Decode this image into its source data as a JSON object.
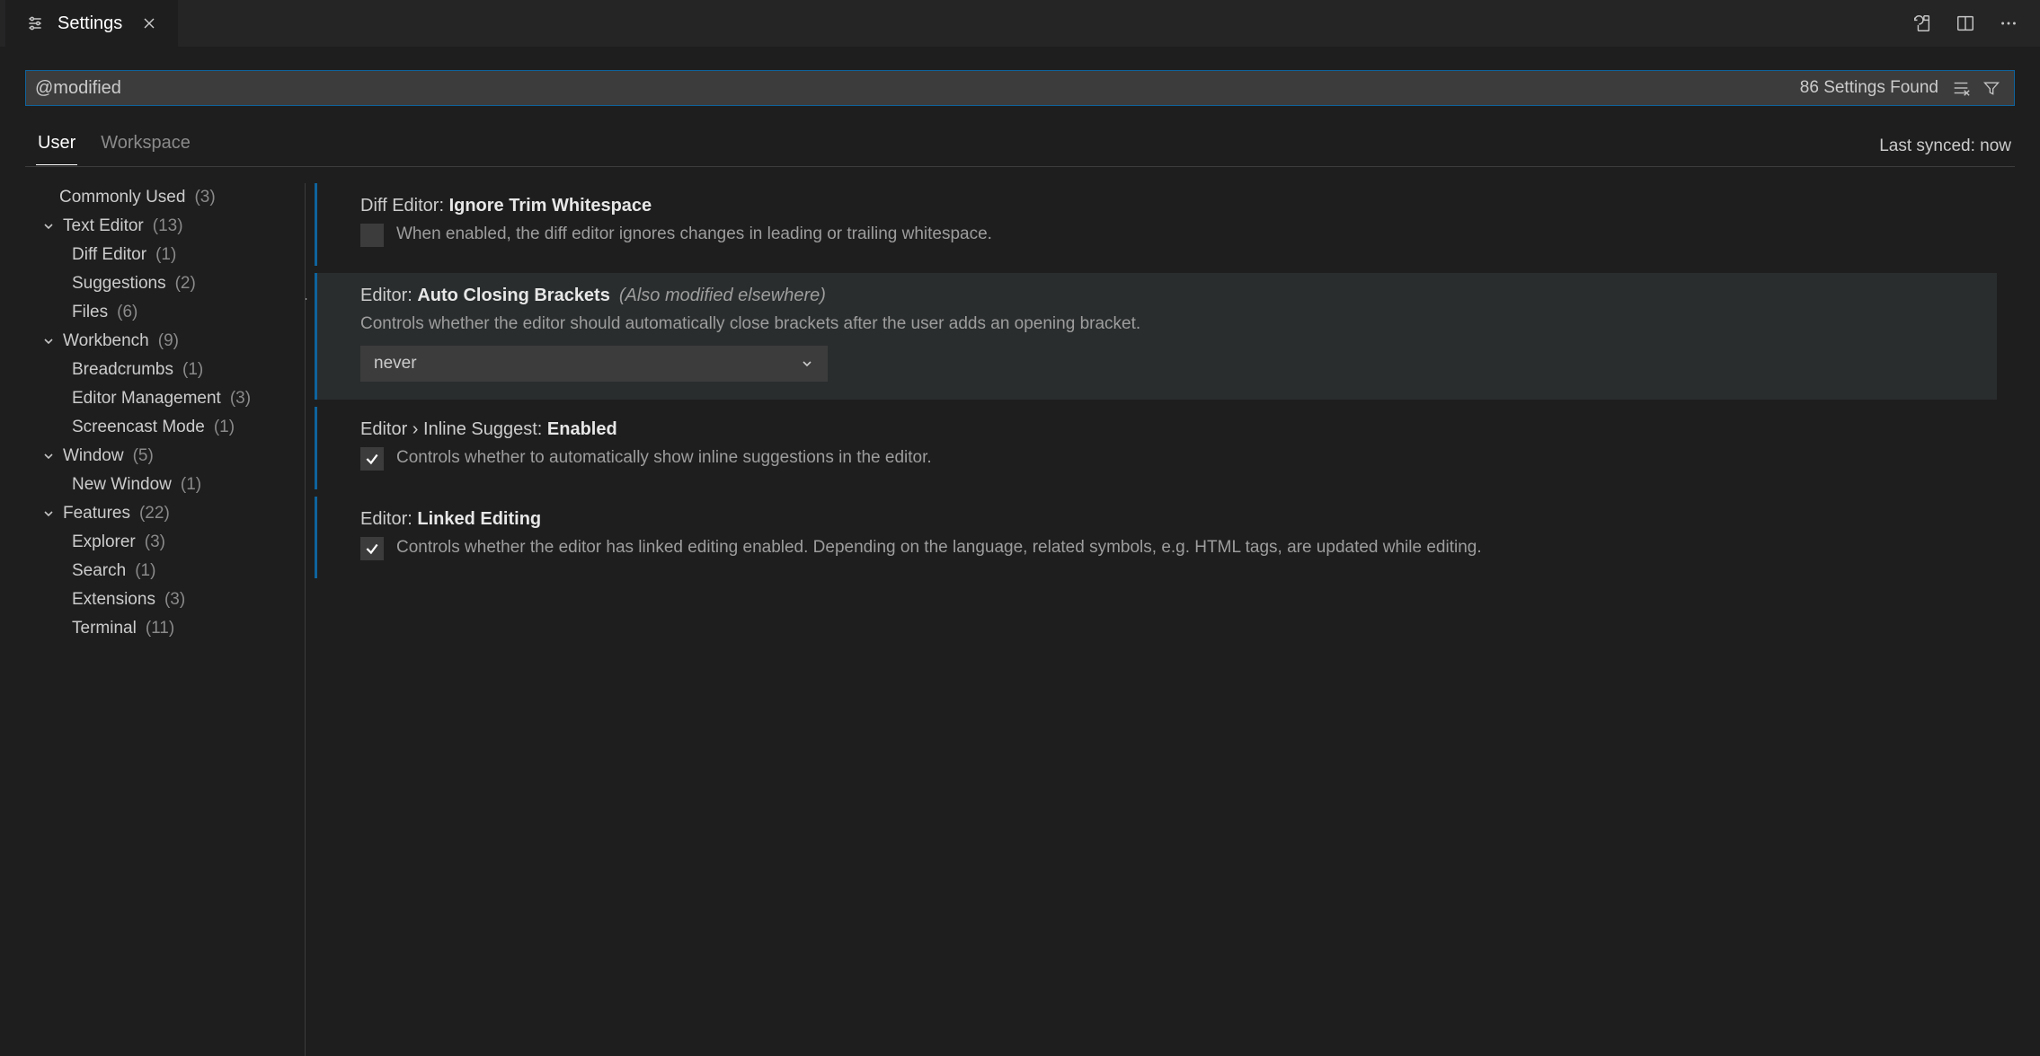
{
  "tab": {
    "title": "Settings"
  },
  "search": {
    "value": "@modified ",
    "count_label": "86 Settings Found"
  },
  "scope": {
    "tabs": [
      "User",
      "Workspace"
    ],
    "active_index": 0,
    "sync_status": "Last synced: now"
  },
  "toc": [
    {
      "kind": "root",
      "label": "Commonly Used",
      "count": "(3)"
    },
    {
      "kind": "section",
      "label": "Text Editor",
      "count": "(13)"
    },
    {
      "kind": "leaf",
      "label": "Diff Editor",
      "count": "(1)"
    },
    {
      "kind": "leaf",
      "label": "Suggestions",
      "count": "(2)"
    },
    {
      "kind": "leaf",
      "label": "Files",
      "count": "(6)"
    },
    {
      "kind": "section",
      "label": "Workbench",
      "count": "(9)"
    },
    {
      "kind": "leaf",
      "label": "Breadcrumbs",
      "count": "(1)"
    },
    {
      "kind": "leaf",
      "label": "Editor Management",
      "count": "(3)"
    },
    {
      "kind": "leaf",
      "label": "Screencast Mode",
      "count": "(1)"
    },
    {
      "kind": "section",
      "label": "Window",
      "count": "(5)"
    },
    {
      "kind": "leaf",
      "label": "New Window",
      "count": "(1)"
    },
    {
      "kind": "section",
      "label": "Features",
      "count": "(22)"
    },
    {
      "kind": "leaf",
      "label": "Explorer",
      "count": "(3)"
    },
    {
      "kind": "leaf",
      "label": "Search",
      "count": "(1)"
    },
    {
      "kind": "leaf",
      "label": "Extensions",
      "count": "(3)"
    },
    {
      "kind": "leaf",
      "label": "Terminal",
      "count": "(11)"
    }
  ],
  "settings": [
    {
      "category": "Diff Editor:",
      "name": "Ignore Trim Whitespace",
      "note": "",
      "type": "checkbox",
      "checked": false,
      "description": "When enabled, the diff editor ignores changes in leading or trailing whitespace.",
      "active": false
    },
    {
      "category": "Editor:",
      "name": "Auto Closing Brackets",
      "note": "(Also modified elsewhere)",
      "type": "select",
      "value": "never",
      "description": "Controls whether the editor should automatically close brackets after the user adds an opening bracket.",
      "active": true
    },
    {
      "category": "Editor › Inline Suggest:",
      "name": "Enabled",
      "note": "",
      "type": "checkbox",
      "checked": true,
      "description": "Controls whether to automatically show inline suggestions in the editor.",
      "active": false
    },
    {
      "category": "Editor:",
      "name": "Linked Editing",
      "note": "",
      "type": "checkbox",
      "checked": true,
      "description": "Controls whether the editor has linked editing enabled. Depending on the language, related symbols, e.g. HTML tags, are updated while editing.",
      "active": false
    }
  ]
}
